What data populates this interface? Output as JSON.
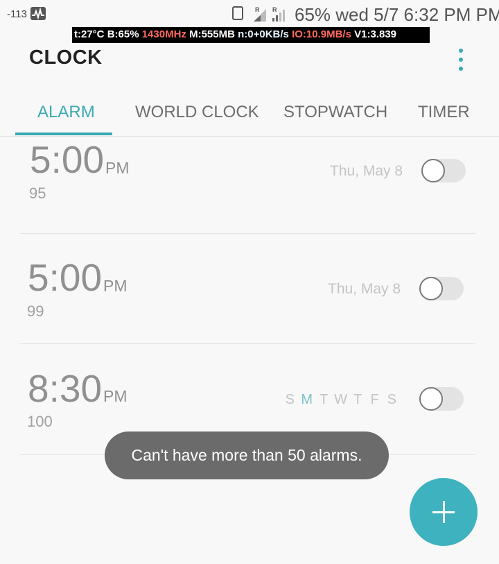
{
  "status_bar": {
    "signal_strength": "-113",
    "right_text": "65% wed 5/7 6:32 PM PM",
    "roaming_1": "R",
    "roaming_2": "R"
  },
  "diagnostics": {
    "temp": "t:27°C",
    "battery": "B:65%",
    "cpu": "1430MHz",
    "mem": "M:555MB",
    "net": "n:0+0KB/s",
    "io": "IO:10.9MB/s",
    "version": "V1:3.839"
  },
  "app": {
    "title": "CLOCK"
  },
  "tabs": [
    {
      "label": "ALARM",
      "active": true
    },
    {
      "label": "WORLD CLOCK",
      "active": false
    },
    {
      "label": "STOPWATCH",
      "active": false
    },
    {
      "label": "TIMER",
      "active": false
    }
  ],
  "alarms": [
    {
      "time": "5:00",
      "ampm": "PM",
      "label": "95",
      "date": "Thu, May 8",
      "enabled": false
    },
    {
      "time": "5:00",
      "ampm": "PM",
      "label": "99",
      "date": "Thu, May 8",
      "enabled": false
    },
    {
      "time": "8:30",
      "ampm": "PM",
      "label": "100",
      "days": [
        "S",
        "M",
        "T",
        "W",
        "T",
        "F",
        "S"
      ],
      "active_days": [
        false,
        true,
        false,
        false,
        false,
        false,
        false
      ],
      "enabled": false
    }
  ],
  "toast": {
    "message": "Can't have more than 50 alarms."
  },
  "colors": {
    "accent": "#3ba9b5",
    "fab": "#3eb2bf",
    "toast_bg": "#6b6b6b"
  },
  "icons": {
    "more": "more-vert-icon",
    "fab": "plus-icon"
  }
}
